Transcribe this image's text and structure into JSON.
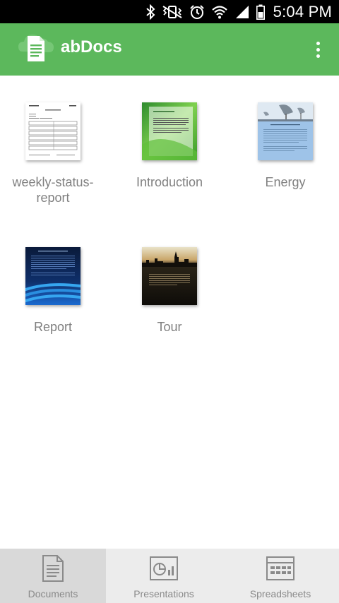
{
  "status_bar": {
    "time": "5:04 PM",
    "icons": [
      "bluetooth-icon",
      "vibrate-icon",
      "alarm-icon",
      "wifi-icon",
      "signal-icon",
      "battery-icon"
    ]
  },
  "app_bar": {
    "title": "abDocs",
    "logo": "document-cloud-logo-icon",
    "menu": "overflow-menu-icon",
    "background_color": "#5cb85c"
  },
  "documents": [
    {
      "name": "weekly-status-report",
      "thumbnail": "text-document-thumbnail"
    },
    {
      "name": "Introduction",
      "thumbnail": "green-document-thumbnail"
    },
    {
      "name": "Energy",
      "thumbnail": "satellite-dish-document-thumbnail"
    },
    {
      "name": "Report",
      "thumbnail": "blue-abstract-document-thumbnail"
    },
    {
      "name": "Tour",
      "thumbnail": "city-skyline-document-thumbnail"
    }
  ],
  "tabs": [
    {
      "label": "Documents",
      "icon": "document-icon",
      "active": true
    },
    {
      "label": "Presentations",
      "icon": "presentation-icon",
      "active": false
    },
    {
      "label": "Spreadsheets",
      "icon": "spreadsheet-icon",
      "active": false
    }
  ]
}
